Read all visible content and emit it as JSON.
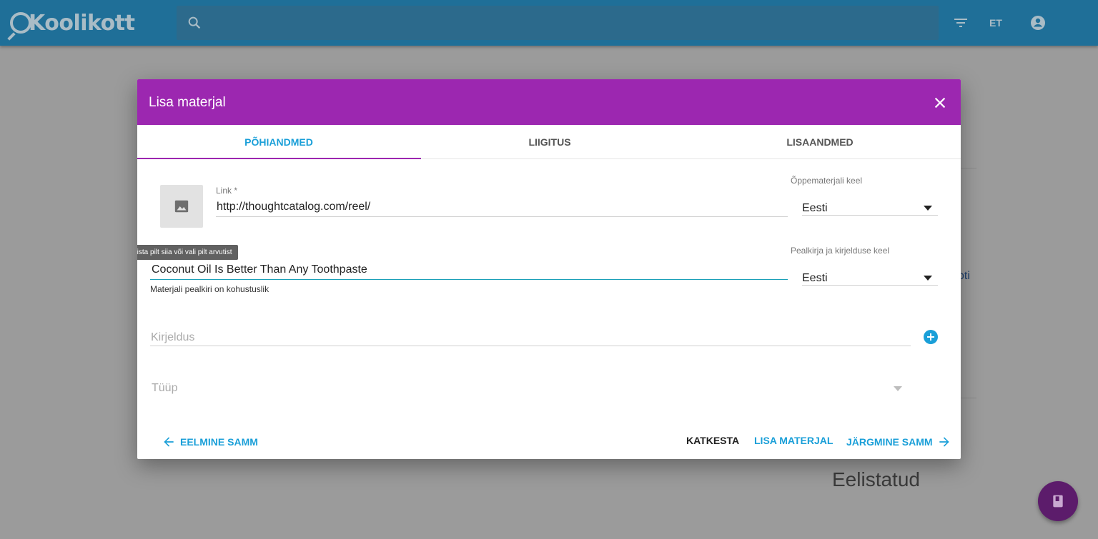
{
  "header": {
    "logo_text": "Koolikott",
    "language": "ET"
  },
  "background": {
    "link_fragment": "oti",
    "section_heading": "Eelistatud"
  },
  "modal": {
    "title": "Lisa materjal",
    "tabs": [
      {
        "label": "PÕHIANDMED",
        "active": true
      },
      {
        "label": "LIIGITUS",
        "active": false
      },
      {
        "label": "LISAANDMED",
        "active": false
      }
    ],
    "image_tooltip": "Lohista pilt siia või vali pilt arvutist",
    "link_field": {
      "label": "Link *",
      "value": "http://thoughtcatalog.com/reel/"
    },
    "title_field": {
      "value": "Coconut Oil Is Better Than Any Toothpaste",
      "hint": "Materjali pealkiri on kohustuslik"
    },
    "material_language": {
      "label": "Õppematerjali keel",
      "value": "Eesti"
    },
    "title_language": {
      "label": "Pealkirja ja kirjelduse keel",
      "value": "Eesti"
    },
    "description_field": {
      "placeholder": "Kirjeldus"
    },
    "type_field": {
      "placeholder": "Tüüp"
    },
    "actions": {
      "previous": "EELMINE SAMM",
      "cancel": "KATKESTA",
      "add": "LISA MATERJAL",
      "next": "JÄRGMINE SAMM"
    }
  },
  "colors": {
    "header_bg": "#1f6f98",
    "modal_header": "#9c27b0",
    "accent": "#1a9fd8",
    "fab": "#5c1c6b"
  }
}
